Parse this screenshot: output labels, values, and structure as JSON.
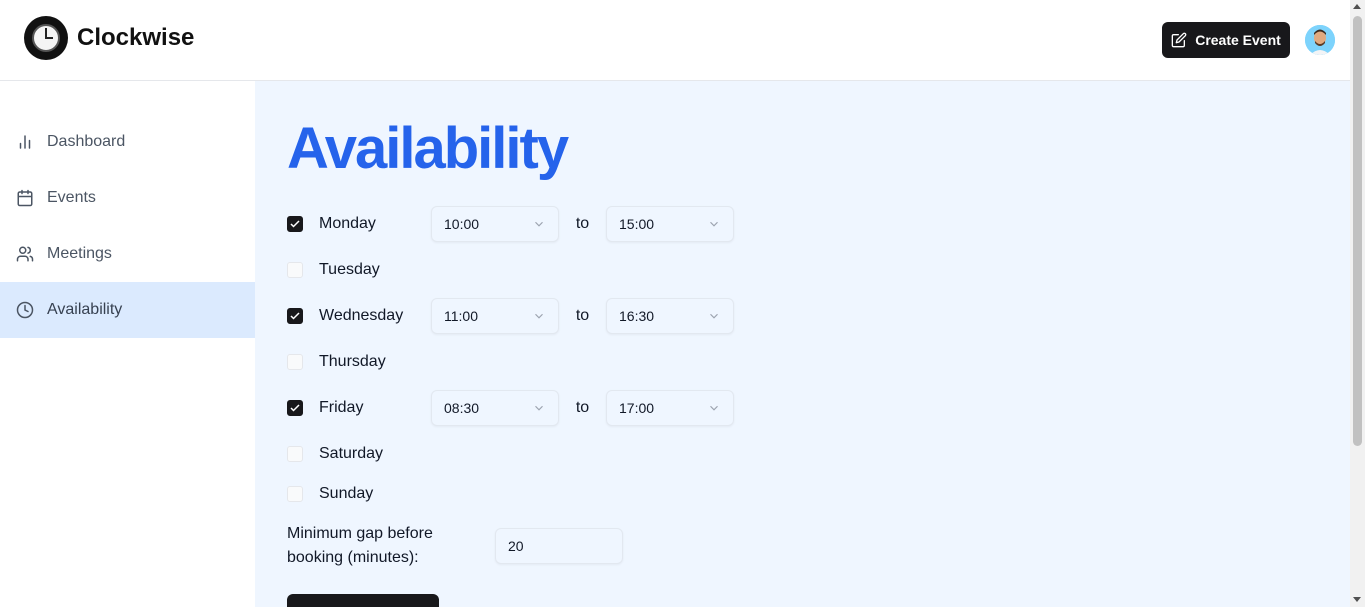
{
  "app": {
    "name": "Clockwise"
  },
  "header": {
    "create_event_label": "Create Event"
  },
  "sidebar": {
    "items": [
      {
        "label": "Dashboard",
        "icon": "bar-chart-icon"
      },
      {
        "label": "Events",
        "icon": "calendar-icon"
      },
      {
        "label": "Meetings",
        "icon": "users-icon"
      },
      {
        "label": "Availability",
        "icon": "clock-icon",
        "active": true
      }
    ]
  },
  "main": {
    "title": "Availability",
    "to_label": "to",
    "days": [
      {
        "day": "Monday",
        "checked": true,
        "start": "10:00",
        "end": "15:00"
      },
      {
        "day": "Tuesday",
        "checked": false
      },
      {
        "day": "Wednesday",
        "checked": true,
        "start": "11:00",
        "end": "16:30"
      },
      {
        "day": "Thursday",
        "checked": false
      },
      {
        "day": "Friday",
        "checked": true,
        "start": "08:30",
        "end": "17:00"
      },
      {
        "day": "Saturday",
        "checked": false
      },
      {
        "day": "Sunday",
        "checked": false
      }
    ],
    "gap_label": "Minimum gap before booking (minutes):",
    "gap_value": "20"
  },
  "colors": {
    "accent": "#2563eb",
    "active_nav_bg": "#dbeafe",
    "main_bg": "#eff6ff",
    "button_bg": "#18181b"
  }
}
